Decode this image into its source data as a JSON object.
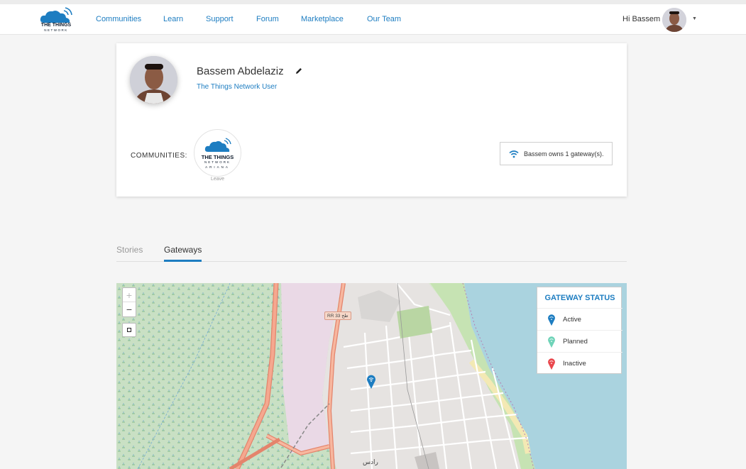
{
  "brand": {
    "logo_text": "THE THINGS",
    "logo_sub": "NETWORK"
  },
  "nav": [
    {
      "label": "Communities"
    },
    {
      "label": "Learn"
    },
    {
      "label": "Support"
    },
    {
      "label": "Forum"
    },
    {
      "label": "Marketplace"
    },
    {
      "label": "Our Team"
    }
  ],
  "user_menu": {
    "greeting": "Hi Bassem"
  },
  "profile": {
    "name": "Bassem Abdelaziz",
    "role": "The Things Network User",
    "communities_label": "COMMUNITIES:",
    "community": {
      "line1": "THE THINGS",
      "line2": "NETWORK",
      "line3": "ARIANA",
      "leave_label": "Leave"
    },
    "gateways_owned_text": "Bassem owns 1 gateway(s)."
  },
  "tabs": [
    {
      "label": "Stories",
      "active": false
    },
    {
      "label": "Gateways",
      "active": true
    }
  ],
  "map": {
    "zoom_in": "+",
    "zoom_out": "−",
    "road_label": "RR 33 طح",
    "place_label": "رادس",
    "legend": {
      "title": "GATEWAY STATUS",
      "items": [
        {
          "label": "Active",
          "color": "#1d7dc1"
        },
        {
          "label": "Planned",
          "color": "#6fd3b8"
        },
        {
          "label": "Inactive",
          "color": "#e9474d"
        }
      ]
    }
  }
}
